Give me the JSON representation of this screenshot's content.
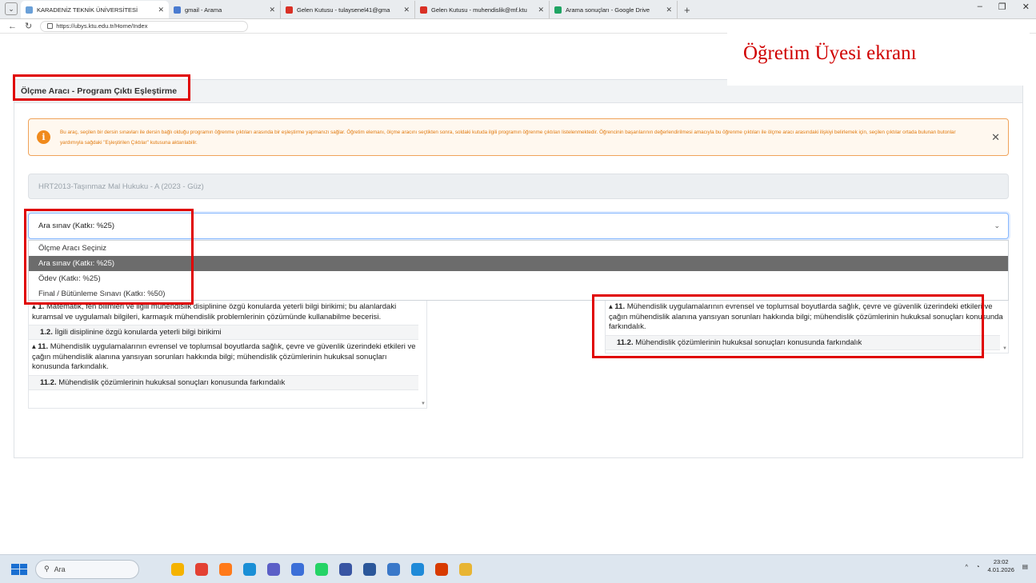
{
  "browser": {
    "tabs": [
      {
        "title": "KARADENİZ TEKNİK ÜNİVERSİTESİ",
        "color": "#6aa0d8",
        "active": true
      },
      {
        "title": "gmail - Arama",
        "color": "#4a7bd0",
        "active": false
      },
      {
        "title": "Gelen Kutusu - tulaysenel41@gma",
        "color": "#d93025",
        "active": false
      },
      {
        "title": "Gelen Kutusu - muhendislik@mf.ktu",
        "color": "#d93025",
        "active": false
      },
      {
        "title": "Arama sonuçları - Google Drive",
        "color": "#1fa463",
        "active": false
      }
    ],
    "url": "https://ubys.ktu.edu.tr/Home/Index"
  },
  "annotation": {
    "text": "Öğretim Üyesi ekranı"
  },
  "card": {
    "title": "Ölçme Aracı - Program Çıktı Eşleştirme",
    "alert_text": "Bu araç, seçilen bir dersin sınavları ile dersin bağlı olduğu programın öğrenme çıktıları arasında bir eşleştirme yapmanızı sağlar. Öğretim elemanı, ölçme aracını seçtikten sonra, soldaki kutuda ilgili programın öğrenme çıktıları listelenmektedir. Öğrencinin başarılarının değerlendirilmesi amacıyla bu öğrenme çıktıları ile ölçme aracı arasındaki ilişkiyi belirlemek için, seçilen çıktılar ortada bulunan butonlar yardımıyla sağdaki \"Eşleştirilen Çıktılar\" kutusuna aktarılabilir.",
    "course": "HRT2013-Taşınmaz Mal Hukuku - A (2023 - Güz)",
    "select_value": "Ara sınav (Katkı: %25)",
    "options": [
      {
        "label": "Ölçme Aracı Seçiniz",
        "selected": false
      },
      {
        "label": "Ara sınav (Katkı: %25)",
        "selected": true
      },
      {
        "label": "Ödev (Katkı: %25)",
        "selected": false
      },
      {
        "label": "Final / Bütünleme Sınavı (Katkı: %50)",
        "selected": false
      }
    ]
  },
  "left_panel": {
    "item1_text": "Matematik, fen bilimleri ve ilgili mühendislik disiplinine özgü konularda yeterli bilgi birikimi; bu alanlardaki kuramsal ve uygulamalı bilgileri, karmaşık mühendislik problemlerinin çözümünde kullanabilme becerisi.",
    "item1_num": "1.",
    "sub1_num": "1.2.",
    "sub1_text": "İlgili disiplinine özgü konularda yeterli bilgi birikimi",
    "item2_num": "11.",
    "item2_text": "Mühendislik uygulamalarının evrensel ve toplumsal boyutlarda sağlık, çevre ve güvenlik üzerindeki etkileri ve çağın mühendislik alanına yansıyan sorunları hakkında bilgi; mühendislik çözümlerinin hukuksal sonuçları konusunda farkındalık.",
    "sub2_num": "11.2.",
    "sub2_text": "Mühendislik çözümlerinin hukuksal sonuçları konusunda farkındalık"
  },
  "right_panel": {
    "item_num": "11.",
    "item_text": "Mühendislik uygulamalarının evrensel ve toplumsal boyutlarda sağlık, çevre ve güvenlik üzerindeki etkileri ve çağın mühendislik alanına yansıyan sorunları hakkında bilgi; mühendislik çözümlerinin hukuksal sonuçları konusunda farkındalık.",
    "sub_num": "11.2.",
    "sub_text": "Mühendislik çözümlerinin hukuksal sonuçları konusunda farkındalık"
  },
  "taskbar": {
    "search_placeholder": "Ara",
    "time": "23:02",
    "date": "4.01.2026",
    "apps": [
      {
        "name": "copilot-icon",
        "color": "#f5b300"
      },
      {
        "name": "chrome-icon",
        "color": "#e34133"
      },
      {
        "name": "firefox-icon",
        "color": "#ff7a1a"
      },
      {
        "name": "edge-icon",
        "color": "#1a8fd6"
      },
      {
        "name": "teams-icon",
        "color": "#5b5fc7"
      },
      {
        "name": "photos-icon",
        "color": "#3c6fd8"
      },
      {
        "name": "whatsapp-icon",
        "color": "#25d366"
      },
      {
        "name": "visio-icon",
        "color": "#3955a3"
      },
      {
        "name": "word-icon",
        "color": "#2b579a"
      },
      {
        "name": "defender-icon",
        "color": "#3a78c9"
      },
      {
        "name": "store-icon",
        "color": "#1f8ad8"
      },
      {
        "name": "office-icon",
        "color": "#d83b01"
      },
      {
        "name": "explorer-icon",
        "color": "#e8b533"
      }
    ]
  }
}
